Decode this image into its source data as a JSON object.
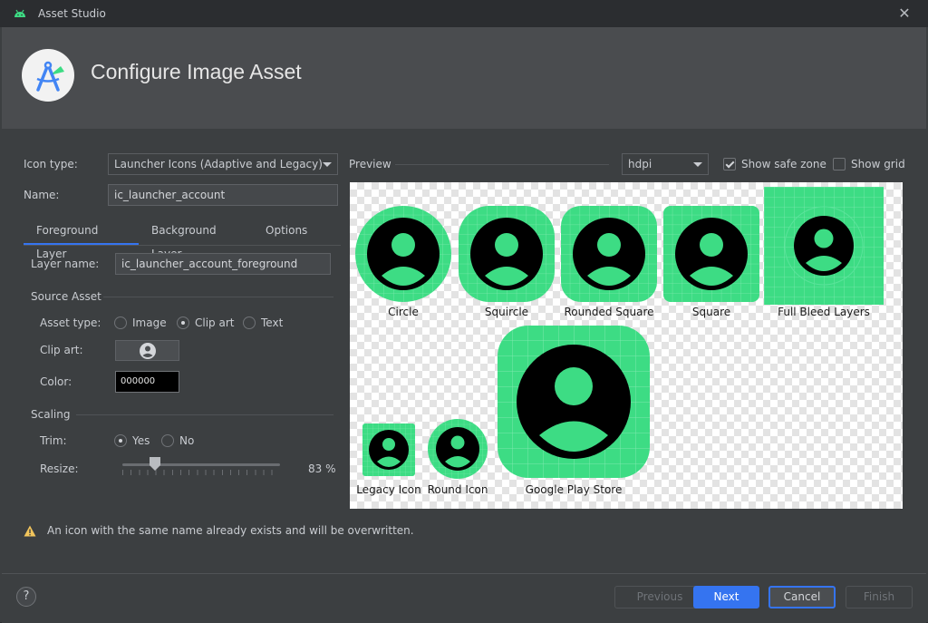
{
  "window": {
    "title": "Asset Studio",
    "close_glyph": "✕"
  },
  "header": {
    "title": "Configure Image Asset"
  },
  "form": {
    "icon_type_label": "Icon type:",
    "icon_type_value": "Launcher Icons (Adaptive and Legacy)",
    "name_label": "Name:",
    "name_value": "ic_launcher_account"
  },
  "tabs": [
    {
      "label": "Foreground Layer",
      "active": true
    },
    {
      "label": "Background Layer",
      "active": false
    },
    {
      "label": "Options",
      "active": false
    }
  ],
  "layer": {
    "layer_name_label": "Layer name:",
    "layer_name_value": "ic_launcher_account_foreground",
    "source_asset_heading": "Source Asset",
    "asset_type_label": "Asset type:",
    "asset_type_options": [
      "Image",
      "Clip art",
      "Text"
    ],
    "asset_type_selected": "Clip art",
    "clip_art_label": "Clip art:",
    "clip_art_icon": "account-circle-icon",
    "color_label": "Color:",
    "color_value": "000000",
    "scaling_heading": "Scaling",
    "trim_label": "Trim:",
    "trim_options": [
      "Yes",
      "No"
    ],
    "trim_selected": "Yes",
    "resize_label": "Resize:",
    "resize_percent": 83,
    "resize_value_text": "83 %"
  },
  "preview": {
    "label": "Preview",
    "density": "hdpi",
    "show_safe_zone_label": "Show safe zone",
    "show_safe_zone": true,
    "show_grid_label": "Show grid",
    "show_grid": false,
    "shapes": [
      "Circle",
      "Squircle",
      "Rounded Square",
      "Square",
      "Full Bleed Layers"
    ],
    "legacy_labels": [
      "Legacy Icon",
      "Round Icon",
      "Google Play Store"
    ],
    "icon_color": "#3ddc84"
  },
  "warning": {
    "text": "An icon with the same name already exists and will be overwritten."
  },
  "footer": {
    "help": "?",
    "previous": "Previous",
    "next": "Next",
    "cancel": "Cancel",
    "finish": "Finish"
  }
}
